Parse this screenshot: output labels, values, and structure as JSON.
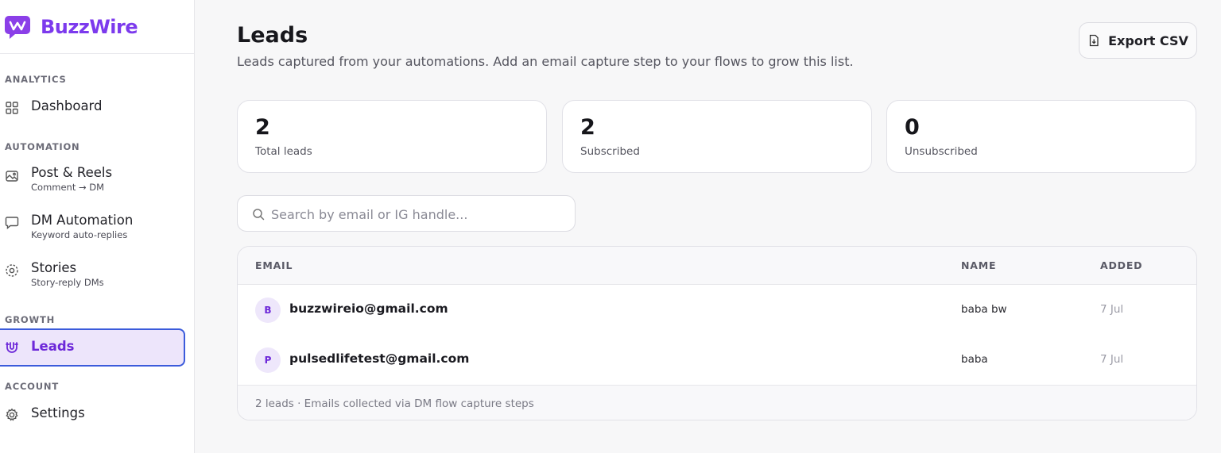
{
  "brand": {
    "name": "BuzzWire",
    "color": "#7c3aed"
  },
  "sidebar": {
    "sections": {
      "analytics": "ANALYTICS",
      "automation": "AUTOMATION",
      "growth": "GROWTH",
      "account": "ACCOUNT"
    },
    "items": [
      {
        "label": "Dashboard",
        "icon": "grid-icon"
      },
      {
        "label": "Post & Reels",
        "sub": "Comment → DM",
        "icon": "image-icon"
      },
      {
        "label": "DM Automation",
        "sub": "Keyword auto-replies",
        "icon": "chat-icon"
      },
      {
        "label": "Stories",
        "sub": "Story-reply DMs",
        "icon": "stories-icon"
      },
      {
        "label": "Leads",
        "icon": "magnet-icon",
        "active": true
      },
      {
        "label": "Settings",
        "icon": "gear-icon"
      }
    ]
  },
  "header": {
    "title": "Leads",
    "subtitle": "Leads captured from your automations. Add an email capture step to your flows to grow this list.",
    "export_label": "Export CSV"
  },
  "stats": [
    {
      "value": "2",
      "label": "Total leads"
    },
    {
      "value": "2",
      "label": "Subscribed"
    },
    {
      "value": "0",
      "label": "Unsubscribed"
    }
  ],
  "search": {
    "placeholder": "Search by email or IG handle...",
    "value": ""
  },
  "table": {
    "columns": {
      "email": "EMAIL",
      "name": "NAME",
      "added": "ADDED"
    },
    "rows": [
      {
        "initial": "B",
        "email": "buzzwireio@gmail.com",
        "name": "baba bw",
        "added": "7 Jul"
      },
      {
        "initial": "P",
        "email": "pulsedlifetest@gmail.com",
        "name": "baba",
        "added": "7 Jul"
      }
    ],
    "footer": "2 leads · Emails collected via DM flow capture steps"
  }
}
